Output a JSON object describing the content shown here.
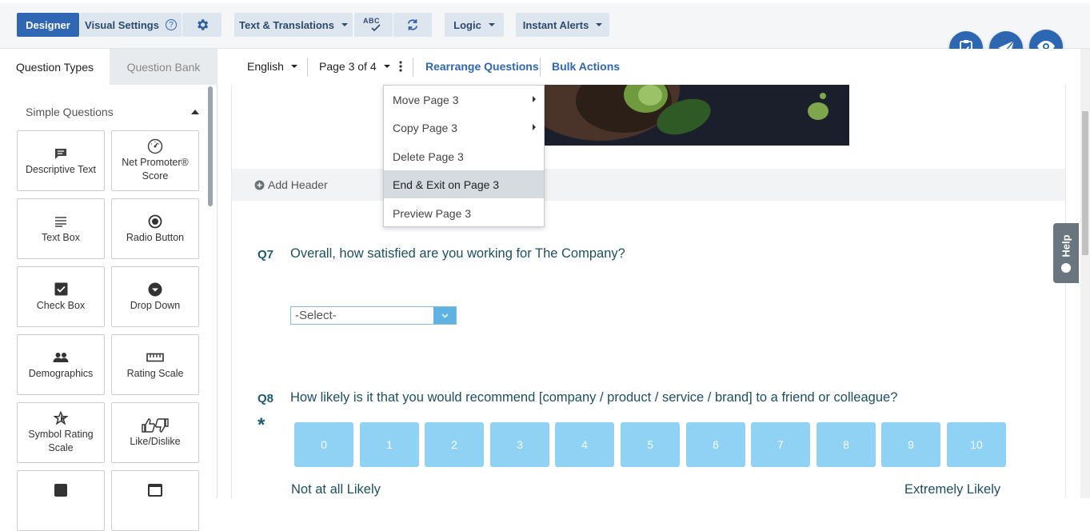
{
  "toolbar": {
    "designer_label": "Designer",
    "visual_settings_label": "Visual Settings",
    "help_mark": "?",
    "text_translations_label": "Text & Translations",
    "spellcheck_label": "ABC",
    "logic_label": "Logic",
    "instant_alerts_label": "Instant Alerts",
    "accent_color": "#2f67b5"
  },
  "sidebar": {
    "tabs": [
      "Question Types",
      "Question Bank"
    ],
    "section_title": "Simple Questions",
    "tiles": [
      {
        "label": "Descriptive Text",
        "icon": "comment-icon"
      },
      {
        "label": "Net Promoter® Score",
        "icon": "gauge-icon"
      },
      {
        "label": "Text Box",
        "icon": "lines-icon"
      },
      {
        "label": "Radio Button",
        "icon": "radio-icon"
      },
      {
        "label": "Check Box",
        "icon": "checkbox-icon"
      },
      {
        "label": "Drop Down",
        "icon": "dropdown-icon"
      },
      {
        "label": "Demographics",
        "icon": "people-icon"
      },
      {
        "label": "Rating Scale",
        "icon": "ruler-icon"
      },
      {
        "label": "Symbol Rating Scale",
        "icon": "star-icon"
      },
      {
        "label": "Like/Dislike",
        "icon": "thumbs-icon"
      }
    ]
  },
  "subbar": {
    "language": "English",
    "page": "Page 3 of 4",
    "rearrange": "Rearrange Questions",
    "bulk": "Bulk Actions"
  },
  "menu": {
    "items": [
      "Move Page 3",
      "Copy Page 3",
      "Delete Page 3",
      "End & Exit on Page 3",
      "Preview Page 3"
    ]
  },
  "content": {
    "add_header": "Add Header",
    "q7_num": "Q7",
    "q7_text": "Overall, how satisfied are you working for The Company?",
    "q7_select": "-Select-",
    "q8_num": "Q8",
    "q8_text": "How likely is it that you would recommend [company / product / service / brand] to a friend or colleague?",
    "required_mark": "*",
    "scale": [
      "0",
      "1",
      "2",
      "3",
      "4",
      "5",
      "6",
      "7",
      "8",
      "9",
      "10"
    ],
    "scale_low": "Not at all Likely",
    "scale_high": "Extremely Likely"
  },
  "help_label": "Help"
}
